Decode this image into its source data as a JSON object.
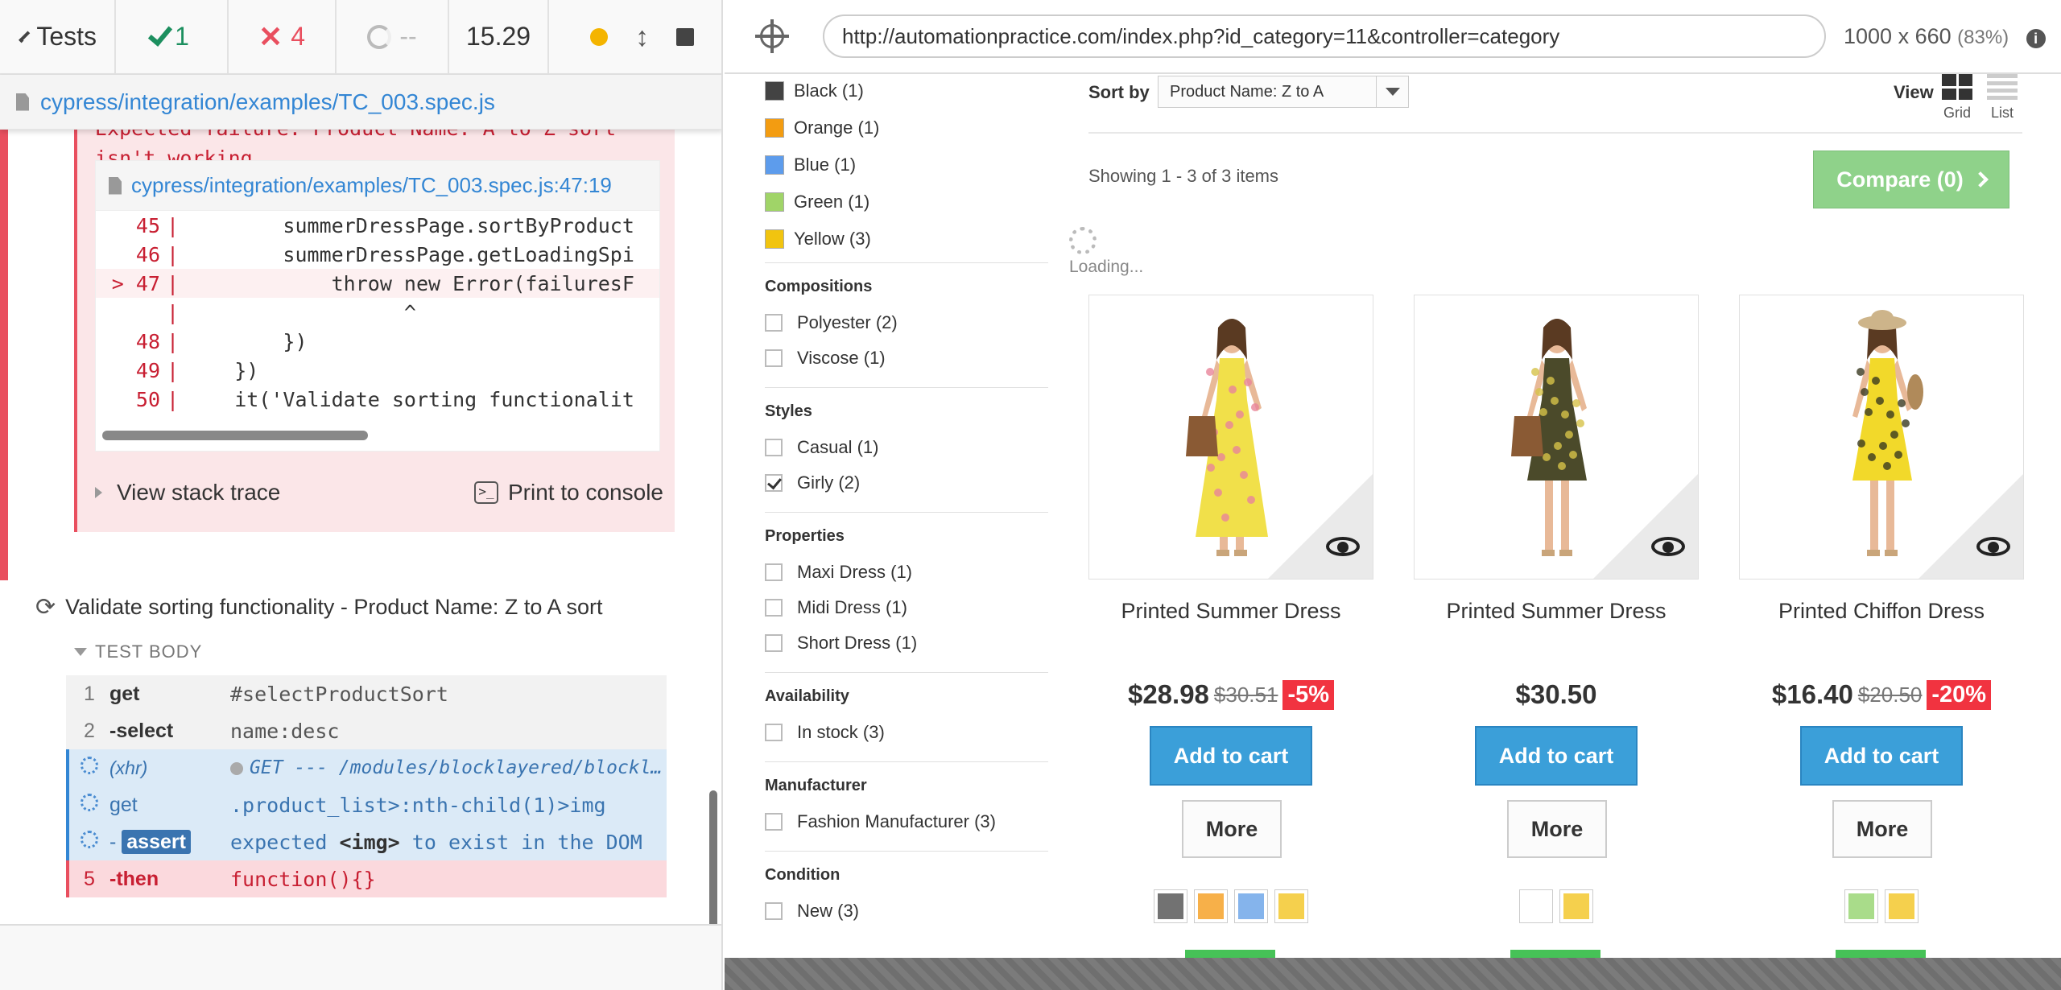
{
  "reporter": {
    "back_label": "Tests",
    "passed": "1",
    "failed": "4",
    "pending": "--",
    "duration": "15.29",
    "spec_path": "cypress/integration/examples/TC_003.spec.js",
    "error": {
      "message_line1": "Expected failure: Product Name: A to Z sort",
      "message_line2": "isn't working",
      "file_ref": "cypress/integration/examples/TC_003.spec.js:47:19",
      "code_lines": [
        {
          "num": "45",
          "marker": "",
          "code": "        summerDressPage.sortByProduct"
        },
        {
          "num": "46",
          "marker": "",
          "code": "        summerDressPage.getLoadingSpi"
        },
        {
          "num": "47",
          "marker": ">",
          "code": "            throw new Error(failuresF"
        },
        {
          "num": "",
          "marker": "",
          "code": "                  ^"
        },
        {
          "num": "48",
          "marker": "",
          "code": "        })"
        },
        {
          "num": "49",
          "marker": "",
          "code": "    })"
        },
        {
          "num": "50",
          "marker": "",
          "code": "    it('Validate sorting functionalit"
        }
      ],
      "view_stack_trace": "View stack trace",
      "print_to_console": "Print to console"
    },
    "running_test_title": "Validate sorting functionality - Product Name: Z to A sort",
    "test_body_label": "TEST BODY",
    "commands": [
      {
        "num": "1",
        "name": "get",
        "message": "#selectProductSort",
        "state": "plain"
      },
      {
        "num": "2",
        "name": "-select",
        "message": "name:desc",
        "state": "plain"
      },
      {
        "num": "",
        "name": "(xhr)",
        "message": "GET --- /modules/blocklayered/blocklaye...",
        "state": "xhr"
      },
      {
        "num": "",
        "name": "get",
        "message": ".product_list>:nth-child(1)>img",
        "state": "pend"
      },
      {
        "num": "",
        "name": "assert",
        "message_pre": "expected ",
        "message_hl": "<img>",
        "message_post": " to exist in the DOM",
        "state": "assert"
      },
      {
        "num": "5",
        "name": "-then",
        "message": "function(){}",
        "state": "failed"
      }
    ]
  },
  "aut": {
    "url": "http://automationpractice.com/index.php?id_category=11&controller=category",
    "viewport": "1000 x 660",
    "scale": "(83%)",
    "filters": {
      "colors": [
        {
          "label": "Black (1)",
          "color": "#434343"
        },
        {
          "label": "Orange (1)",
          "color": "#f39c11"
        },
        {
          "label": "Blue (1)",
          "color": "#5d9cec"
        },
        {
          "label": "Green (1)",
          "color": "#a0d468"
        },
        {
          "label": "Yellow (3)",
          "color": "#f1c40f"
        }
      ],
      "groups": [
        {
          "title": "Compositions",
          "options": [
            {
              "label": "Polyester (2)",
              "checked": false
            },
            {
              "label": "Viscose (1)",
              "checked": false
            }
          ]
        },
        {
          "title": "Styles",
          "options": [
            {
              "label": "Casual (1)",
              "checked": false
            },
            {
              "label": "Girly (2)",
              "checked": true
            }
          ]
        },
        {
          "title": "Properties",
          "options": [
            {
              "label": "Maxi Dress (1)",
              "checked": false
            },
            {
              "label": "Midi Dress (1)",
              "checked": false
            },
            {
              "label": "Short Dress (1)",
              "checked": false
            }
          ]
        },
        {
          "title": "Availability",
          "options": [
            {
              "label": "In stock (3)",
              "checked": false
            }
          ]
        },
        {
          "title": "Manufacturer",
          "options": [
            {
              "label": "Fashion Manufacturer (3)",
              "checked": false
            }
          ]
        },
        {
          "title": "Condition",
          "options": [
            {
              "label": "New (3)",
              "checked": false
            }
          ]
        }
      ]
    },
    "sort_label": "Sort by",
    "sort_value": "Product Name: Z to A",
    "view_label": "View",
    "grid_label": "Grid",
    "list_label": "List",
    "showing": "Showing 1 - 3 of 3 items",
    "compare": "Compare (0)",
    "loading": "Loading...",
    "products": [
      {
        "name": "Printed Summer Dress",
        "price": "$28.98",
        "old_price": "$30.51",
        "discount": "-5%",
        "cart": "Add to cart",
        "more": "More",
        "colors": [
          "#727272",
          "#f7b049",
          "#85b4ec",
          "#f5d04d"
        ],
        "dress": "#f1e04a",
        "pattern": "#e8849a"
      },
      {
        "name": "Printed Summer Dress",
        "price": "$30.50",
        "old_price": "",
        "discount": "",
        "cart": "Add to cart",
        "more": "More",
        "colors": [
          "#ffffff",
          "#f5d04d"
        ],
        "dress": "#4b4a2a",
        "pattern": "#d6c248"
      },
      {
        "name": "Printed Chiffon Dress",
        "price": "$16.40",
        "old_price": "$20.50",
        "discount": "-20%",
        "cart": "Add to cart",
        "more": "More",
        "colors": [
          "#a9dc8a",
          "#f5d04d"
        ],
        "dress": "#f2d92a",
        "pattern": "#3a3a20"
      }
    ]
  }
}
